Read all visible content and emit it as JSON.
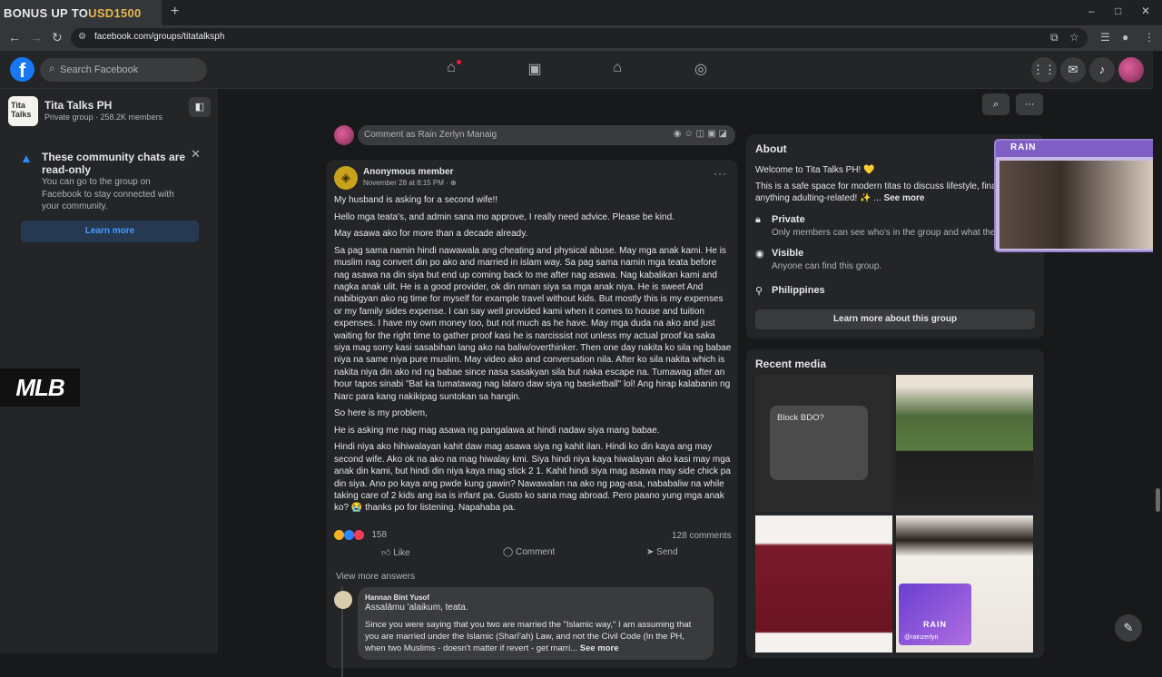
{
  "browser": {
    "tab_title_prefix": "BONUS UP TO ",
    "tab_title_amount": "USD1500",
    "new_tab": "+",
    "url": "facebook.com/groups/titatalksph",
    "window_controls": [
      "–",
      "□",
      "✕"
    ]
  },
  "header": {
    "logo": "f",
    "search_placeholder": "Search Facebook",
    "nav_icons": [
      "home-icon",
      "video-icon",
      "marketplace-icon",
      "groups-icon"
    ],
    "right_icons": [
      "menu-grid-icon",
      "messenger-icon",
      "notifications-icon"
    ]
  },
  "sidebar": {
    "group_icon_text": "Tita Talks",
    "group_name": "Tita Talks PH",
    "group_meta": "Private group · 258.2K members",
    "notice_title": "These community chats are read-only",
    "notice_body": "You can go to the group on Facebook to stay connected with your community.",
    "notice_button": "Learn more"
  },
  "composer": {
    "placeholder": "Comment as Rain Zerlyn Manaig"
  },
  "post": {
    "author": "Anonymous member",
    "date": "November 28 at 8:15 PM · ⊕",
    "paragraphs": [
      "My husband is asking for a second wife!!",
      "Hello mga teata's, and admin sana mo approve, I really need advice. Please be kind.",
      "May asawa ako for more than a decade already.",
      "Sa pag sama namin hindi nawawala ang cheating and physical abuse. May mga anak kami. He is muslim nag convert din po ako and married in islam way. Sa pag sama namin mga teata before nag asawa na din siya but end up coming back to me after nag asawa. Nag kabalikan kami and nagka anak ulit. He is a good provider, ok din nman siya sa mga anak niya. He is sweet And nabibigyan ako ng time for myself for example travel without kids. But mostly this is my expenses or my family sides expense. I can say well provided kami when it comes to house and tuition expenses. I have my own money too, but not much as he have. May mga duda na ako and just waiting for the right time to gather proof kasi he is narcissist not unless my actual proof ka saka siya mag sorry kasi sasabihan lang ako na baliw/overthinker. Then one day nakita ko sila ng babae niya na same niya pure muslim. May video ako and conversation nila. After ko sila nakita which is nakita niya din ako nd ng babae since nasa sasakyan sila but naka escape na. Tumawag after an hour tapos sinabi \"Bat ka tumatawag nag lalaro daw siya ng basketball\" lol! Ang hirap kalabanin ng Narc para kang nakikipag suntokan sa hangin.",
      "So here is my problem,",
      "He is asking me nag mag asawa ng pangalawa at hindi nadaw siya mang babae.",
      "Hindi niya ako hihiwalayan kahit daw mag asawa siya ng kahit ilan. Hindi ko din kaya ang may second wife. Ako ok na ako na mag hiwalay kmi. Siya hindi niya kaya hiwalayan ako kasi may mga anak din kami, but hindi din niya kaya mag stick 2 1. Kahit hindi siya mag asawa may side chick pa din siya. Ano po kaya ang pwde kung gawin? Nawawalan na ako ng pag-asa, nababaliw na while taking care of 2 kids ang isa is infant pa. Gusto ko sana mag abroad. Pero paano yung mga anak ko? 😭 thanks po for listening. Napahaba pa."
    ],
    "reaction_count": "158",
    "comments_count": "128 comments",
    "actions": [
      "Like",
      "Comment",
      "Send"
    ],
    "view_more": "View more answers",
    "reply": {
      "name": "Hannan Bint Yusof",
      "greeting": "Assalāmu 'alaikum, teata.",
      "text": "Since you were saying that you two are married the \"Islamic way,\" I am assuming that you are married under the Islamic (Sharī'ah) Law, and not the Civil Code (In the PH, when two Muslims - doesn't matter if revert - get marri...",
      "see_more": "See more"
    }
  },
  "about": {
    "title": "About",
    "desc": "Welcome to Tita Talks PH! 💛",
    "desc2": "This is a safe space for modern titas to discuss lifestyle, finar... anything adulting-related! ✨ ...",
    "see_more": "See more",
    "private_title": "Private",
    "private_sub": "Only members can see who's in the group and what the",
    "visible_title": "Visible",
    "visible_sub": "Anyone can find this group.",
    "location": "Philippines",
    "button": "Learn more about this group"
  },
  "media": {
    "title": "Recent media",
    "bdo_title": "Block BDO?"
  },
  "overlay": {
    "cam_brand": "RAIN",
    "badge_brand": "RAIN",
    "badge_handle": "@rainzerlyn",
    "side_logo": "MLB"
  }
}
